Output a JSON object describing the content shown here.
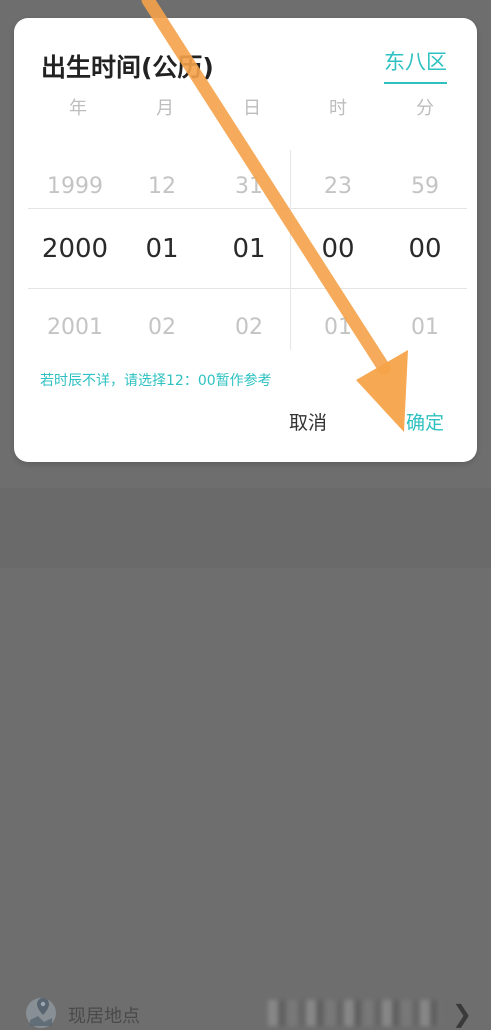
{
  "dialog": {
    "title": "出生时间(公历)",
    "timezone": "东八区",
    "columns": [
      "年",
      "月",
      "日",
      "时",
      "分"
    ],
    "wheel": {
      "above": [
        "1999",
        "12",
        "31",
        "23",
        "59"
      ],
      "selected": [
        "2000",
        "01",
        "01",
        "00",
        "00"
      ],
      "below": [
        "2001",
        "02",
        "02",
        "01",
        "01"
      ]
    },
    "hint": "若时辰不详，请选择12：00暂作参考",
    "cancel_label": "取消",
    "confirm_label": "确定"
  },
  "background": {
    "location_label": "现居地点"
  },
  "colors": {
    "accent": "#2fc1c1",
    "annotation_arrow": "#f5a34a"
  },
  "icons": [
    "location-icon",
    "chevron-right-icon"
  ]
}
